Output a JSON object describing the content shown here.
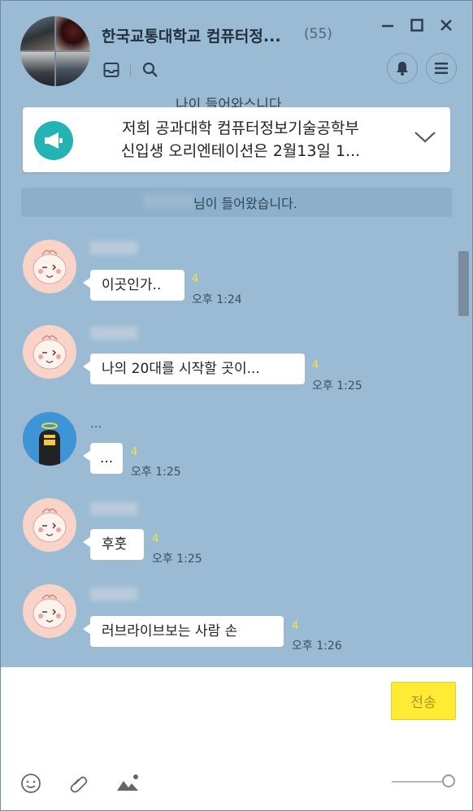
{
  "header": {
    "title": "한국교통대학교 컴퓨터정...",
    "member_count": "(55)",
    "icons": [
      "group-avatar",
      "inbox-icon",
      "search-icon",
      "minimize-icon",
      "maximize-icon",
      "close-icon",
      "bell-icon",
      "menu-icon"
    ]
  },
  "notice": {
    "line1": "저희 공과대학 컴퓨터정보기술공학부",
    "line2": "신입생 오리엔테이션은 2월13일 1...",
    "partial_above": "나이 들어와스니다"
  },
  "system_message": "님이 들어왔습니다.",
  "messages": [
    {
      "sender": "",
      "text": "이곳인가..",
      "unread": "4",
      "time": "오후 1:24"
    },
    {
      "sender": "",
      "text": "나의 20대를 시작할 곳이...",
      "unread": "4",
      "time": "오후 1:25"
    },
    {
      "sender": "...",
      "text": "...",
      "unread": "4",
      "time": "오후 1:25"
    },
    {
      "sender": "",
      "text": "후훗",
      "unread": "4",
      "time": "오후 1:25"
    },
    {
      "sender": "",
      "text": "러브라이브보는 사람 손",
      "unread": "4",
      "time": "오후 1:26"
    }
  ],
  "input": {
    "send_label": "전송",
    "tools": [
      "emoticon-icon",
      "attach-icon",
      "image-icon"
    ]
  },
  "colors": {
    "chat_background": "#9bbbd4",
    "send_button": "#ffeb33",
    "unread_count": "#f3e53f",
    "notice_icon": "#23b3b5"
  }
}
